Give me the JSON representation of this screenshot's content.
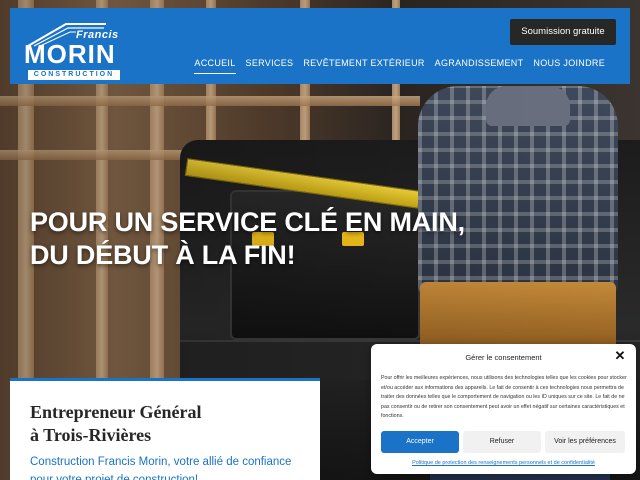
{
  "brand": {
    "logo_top": "Francis",
    "logo_main": "MORIN",
    "logo_sub": "CONSTRUCTION"
  },
  "header": {
    "cta_label": "Soumission gratuite",
    "nav": [
      {
        "label": "ACCUEIL",
        "active": true
      },
      {
        "label": "SERVICES",
        "active": false
      },
      {
        "label": "REVÊTEMENT EXTÉRIEUR",
        "active": false
      },
      {
        "label": "AGRANDISSEMENT",
        "active": false
      },
      {
        "label": "NOUS JOINDRE",
        "active": false
      }
    ]
  },
  "hero": {
    "line1": "POUR UN SERVICE CLÉ EN MAIN,",
    "line2": "DU DÉBUT À LA FIN!"
  },
  "intro": {
    "title_line1": "Entrepreneur Général",
    "title_line2": "à Trois-Rivières",
    "text": "Construction Francis Morin, votre allié de confiance pour votre projet de construction!"
  },
  "consent": {
    "title": "Gérer le consentement",
    "body": "Pour offrir les meilleures expériences, nous utilisons des technologies telles que les cookies pour stocker et/ou accéder aux informations des appareils. Le fait de consentir à ces technologies nous permettra de traiter des données telles que le comportement de navigation ou les ID uniques sur ce site. Le fait de ne pas consentir ou de retirer son consentement peut avoir un effet négatif sur certaines caractéristiques et fonctions.",
    "accept": "Accepter",
    "refuse": "Refuser",
    "preferences": "Voir les préférences",
    "policy": "Politique de protection des renseignements personnels et de confidentialité"
  },
  "colors": {
    "brand_blue": "#1a73c7",
    "cta_dark": "#272727"
  }
}
